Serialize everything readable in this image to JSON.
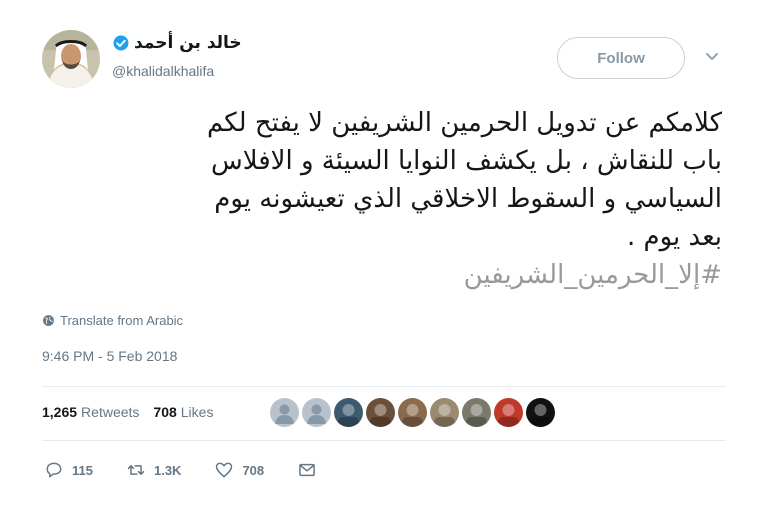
{
  "author": {
    "display_name": "خالد بن أحمد",
    "handle": "@khalidalkhalifa",
    "verified": true,
    "avatar_icon": "user-avatar"
  },
  "follow_label": "Follow",
  "tweet": {
    "lines": [
      "كلامكم عن تدويل الحرمين الشريفين لا يفتح لكم",
      "باب للنقاش ، بل يكشف النوايا السيئة و الافلاس",
      "السياسي و السقوط الاخلاقي الذي تعيشونه يوم",
      "بعد يوم ."
    ],
    "hashtag": "#إلا_الحرمين_الشريفين"
  },
  "translate_label": "Translate from Arabic",
  "timestamp": "9:46 PM - 5 Feb 2018",
  "stats": {
    "retweets_count": "1,265",
    "retweets_label": "Retweets",
    "likes_count": "708",
    "likes_label": "Likes"
  },
  "likers": [
    {
      "icon": "default-avatar",
      "color": "#b8c2cc"
    },
    {
      "icon": "default-avatar",
      "color": "#b8c2cc"
    },
    {
      "icon": "user-avatar",
      "color": "#3d5a6e"
    },
    {
      "icon": "user-avatar",
      "color": "#6b4f3a"
    },
    {
      "icon": "user-avatar",
      "color": "#8a6b4e"
    },
    {
      "icon": "user-avatar",
      "color": "#9a8a70"
    },
    {
      "icon": "user-avatar",
      "color": "#7a7a6a"
    },
    {
      "icon": "user-avatar",
      "color": "#c0392b"
    },
    {
      "icon": "user-avatar",
      "color": "#111111"
    }
  ],
  "actions": {
    "reply_count": "115",
    "retweet_count": "1.3K",
    "like_count": "708"
  },
  "colors": {
    "verified": "#1da1f2",
    "hashtag": "#999999",
    "muted": "#657786"
  }
}
